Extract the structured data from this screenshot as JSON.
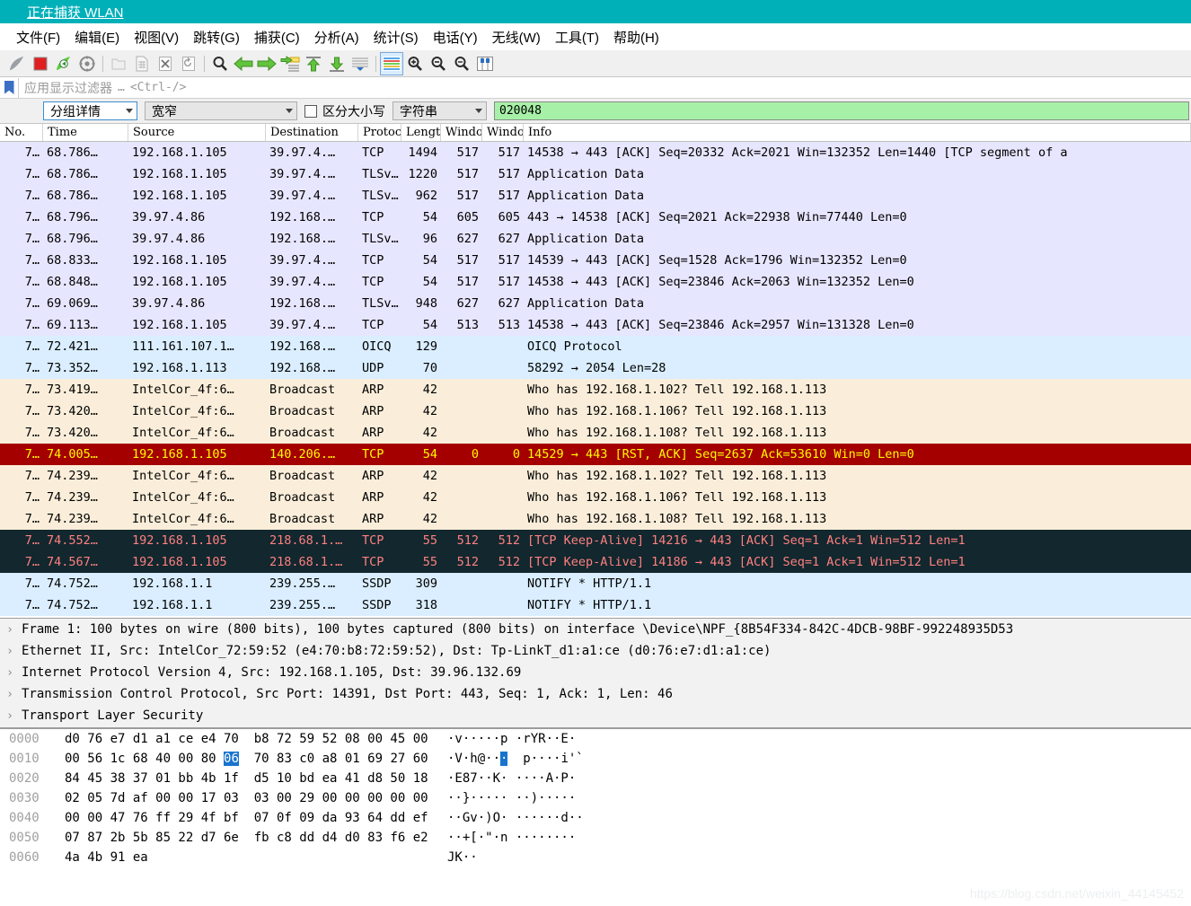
{
  "window": {
    "title": "正在捕获 WLAN",
    "title_icon": "wireshark-shark-fin-icon",
    "titlebar_color": "#00b0b9"
  },
  "menubar": {
    "items": [
      {
        "label": "文件(F)",
        "name": "menu-file"
      },
      {
        "label": "编辑(E)",
        "name": "menu-edit"
      },
      {
        "label": "视图(V)",
        "name": "menu-view"
      },
      {
        "label": "跳转(G)",
        "name": "menu-go"
      },
      {
        "label": "捕获(C)",
        "name": "menu-capture"
      },
      {
        "label": "分析(A)",
        "name": "menu-analyze"
      },
      {
        "label": "统计(S)",
        "name": "menu-statistics"
      },
      {
        "label": "电话(Y)",
        "name": "menu-telephony"
      },
      {
        "label": "无线(W)",
        "name": "menu-wireless"
      },
      {
        "label": "工具(T)",
        "name": "menu-tools"
      },
      {
        "label": "帮助(H)",
        "name": "menu-help"
      }
    ]
  },
  "toolbar": {
    "buttons": [
      {
        "name": "start-capture-icon"
      },
      {
        "name": "stop-capture-icon"
      },
      {
        "name": "restart-capture-icon"
      },
      {
        "name": "capture-options-icon"
      },
      {
        "sep": true
      },
      {
        "name": "open-file-icon"
      },
      {
        "name": "save-file-icon"
      },
      {
        "name": "close-file-icon"
      },
      {
        "name": "reload-file-icon"
      },
      {
        "sep": true
      },
      {
        "name": "find-packet-icon"
      },
      {
        "name": "go-back-icon"
      },
      {
        "name": "go-forward-icon"
      },
      {
        "name": "go-to-packet-icon"
      },
      {
        "name": "go-to-first-packet-icon"
      },
      {
        "name": "go-to-last-packet-icon"
      },
      {
        "name": "auto-scroll-icon"
      },
      {
        "sep": true
      },
      {
        "name": "colorize-packets-icon",
        "active": true
      },
      {
        "name": "zoom-in-icon"
      },
      {
        "name": "zoom-out-icon"
      },
      {
        "name": "zoom-reset-icon"
      },
      {
        "name": "resize-columns-icon"
      }
    ]
  },
  "filterbar": {
    "bookmark_icon": "bookmark-icon",
    "placeholder": "应用显示过滤器",
    "ellipsis": "…",
    "shortcut": "<Ctrl-/>",
    "value": ""
  },
  "findbar": {
    "search_in": {
      "value": "分组详情",
      "name": "search-in-combo"
    },
    "char_width": {
      "value": "宽窄",
      "name": "char-width-combo"
    },
    "case_sensitive": {
      "label": "区分大小写",
      "checked": false
    },
    "search_type": {
      "value": "字符串",
      "name": "search-type-combo"
    },
    "find_value": "020048"
  },
  "packet_list": {
    "columns": [
      {
        "key": "no",
        "label": "No."
      },
      {
        "key": "time",
        "label": "Time"
      },
      {
        "key": "src",
        "label": "Source"
      },
      {
        "key": "dst",
        "label": "Destination"
      },
      {
        "key": "proto",
        "label": "Protoc"
      },
      {
        "key": "len",
        "label": "Lengt"
      },
      {
        "key": "win1",
        "label": "Windo"
      },
      {
        "key": "win2",
        "label": "Windo"
      },
      {
        "key": "info",
        "label": "Info"
      }
    ],
    "rows": [
      {
        "no": "7…",
        "time": "68.786…",
        "src": "192.168.1.105",
        "dst": "39.97.4.…",
        "proto": "TCP",
        "len": "1494",
        "win1": "517",
        "win2": "517",
        "info": "14538 → 443 [ACK] Seq=20332 Ack=2021 Win=132352 Len=1440 [TCP segment of a",
        "style": "bg-tcp"
      },
      {
        "no": "7…",
        "time": "68.786…",
        "src": "192.168.1.105",
        "dst": "39.97.4.…",
        "proto": "TLSv…",
        "len": "1220",
        "win1": "517",
        "win2": "517",
        "info": "Application Data",
        "style": "bg-tcp"
      },
      {
        "no": "7…",
        "time": "68.786…",
        "src": "192.168.1.105",
        "dst": "39.97.4.…",
        "proto": "TLSv…",
        "len": "962",
        "win1": "517",
        "win2": "517",
        "info": "Application Data",
        "style": "bg-tcp"
      },
      {
        "no": "7…",
        "time": "68.796…",
        "src": "39.97.4.86",
        "dst": "192.168.…",
        "proto": "TCP",
        "len": "54",
        "win1": "605",
        "win2": "605",
        "info": "443 → 14538 [ACK] Seq=2021 Ack=22938 Win=77440 Len=0",
        "style": "bg-tcp"
      },
      {
        "no": "7…",
        "time": "68.796…",
        "src": "39.97.4.86",
        "dst": "192.168.…",
        "proto": "TLSv…",
        "len": "96",
        "win1": "627",
        "win2": "627",
        "info": "Application Data",
        "style": "bg-tcp"
      },
      {
        "no": "7…",
        "time": "68.833…",
        "src": "192.168.1.105",
        "dst": "39.97.4.…",
        "proto": "TCP",
        "len": "54",
        "win1": "517",
        "win2": "517",
        "info": "14539 → 443 [ACK] Seq=1528 Ack=1796 Win=132352 Len=0",
        "style": "bg-tcp"
      },
      {
        "no": "7…",
        "time": "68.848…",
        "src": "192.168.1.105",
        "dst": "39.97.4.…",
        "proto": "TCP",
        "len": "54",
        "win1": "517",
        "win2": "517",
        "info": "14538 → 443 [ACK] Seq=23846 Ack=2063 Win=132352 Len=0",
        "style": "bg-tcp"
      },
      {
        "no": "7…",
        "time": "69.069…",
        "src": "39.97.4.86",
        "dst": "192.168.…",
        "proto": "TLSv…",
        "len": "948",
        "win1": "627",
        "win2": "627",
        "info": "Application Data",
        "style": "bg-tcp"
      },
      {
        "no": "7…",
        "time": "69.113…",
        "src": "192.168.1.105",
        "dst": "39.97.4.…",
        "proto": "TCP",
        "len": "54",
        "win1": "513",
        "win2": "513",
        "info": "14538 → 443 [ACK] Seq=23846 Ack=2957 Win=131328 Len=0",
        "style": "bg-tcp"
      },
      {
        "no": "7…",
        "time": "72.421…",
        "src": "111.161.107.1…",
        "dst": "192.168.…",
        "proto": "OICQ",
        "len": "129",
        "win1": "",
        "win2": "",
        "info": "OICQ Protocol",
        "style": "bg-udp"
      },
      {
        "no": "7…",
        "time": "73.352…",
        "src": "192.168.1.113",
        "dst": "192.168.…",
        "proto": "UDP",
        "len": "70",
        "win1": "",
        "win2": "",
        "info": "58292 → 2054 Len=28",
        "style": "bg-udp"
      },
      {
        "no": "7…",
        "time": "73.419…",
        "src": "IntelCor_4f:6…",
        "dst": "Broadcast",
        "proto": "ARP",
        "len": "42",
        "win1": "",
        "win2": "",
        "info": "Who has 192.168.1.102? Tell 192.168.1.113",
        "style": "bg-arp"
      },
      {
        "no": "7…",
        "time": "73.420…",
        "src": "IntelCor_4f:6…",
        "dst": "Broadcast",
        "proto": "ARP",
        "len": "42",
        "win1": "",
        "win2": "",
        "info": "Who has 192.168.1.106? Tell 192.168.1.113",
        "style": "bg-arp"
      },
      {
        "no": "7…",
        "time": "73.420…",
        "src": "IntelCor_4f:6…",
        "dst": "Broadcast",
        "proto": "ARP",
        "len": "42",
        "win1": "",
        "win2": "",
        "info": "Who has 192.168.1.108? Tell 192.168.1.113",
        "style": "bg-arp"
      },
      {
        "no": "7…",
        "time": "74.005…",
        "src": "192.168.1.105",
        "dst": "140.206.…",
        "proto": "TCP",
        "len": "54",
        "win1": "0",
        "win2": "0",
        "info": "14529 → 443 [RST, ACK] Seq=2637 Ack=53610 Win=0 Len=0",
        "style": "bg-bad"
      },
      {
        "no": "7…",
        "time": "74.239…",
        "src": "IntelCor_4f:6…",
        "dst": "Broadcast",
        "proto": "ARP",
        "len": "42",
        "win1": "",
        "win2": "",
        "info": "Who has 192.168.1.102? Tell 192.168.1.113",
        "style": "bg-arp"
      },
      {
        "no": "7…",
        "time": "74.239…",
        "src": "IntelCor_4f:6…",
        "dst": "Broadcast",
        "proto": "ARP",
        "len": "42",
        "win1": "",
        "win2": "",
        "info": "Who has 192.168.1.106? Tell 192.168.1.113",
        "style": "bg-arp"
      },
      {
        "no": "7…",
        "time": "74.239…",
        "src": "IntelCor_4f:6…",
        "dst": "Broadcast",
        "proto": "ARP",
        "len": "42",
        "win1": "",
        "win2": "",
        "info": "Who has 192.168.1.108? Tell 192.168.1.113",
        "style": "bg-arp"
      },
      {
        "no": "7…",
        "time": "74.552…",
        "src": "192.168.1.105",
        "dst": "218.68.1.…",
        "proto": "TCP",
        "len": "55",
        "win1": "512",
        "win2": "512",
        "info": "[TCP Keep-Alive] 14216 → 443 [ACK] Seq=1 Ack=1 Win=512 Len=1",
        "style": "bg-keepalive"
      },
      {
        "no": "7…",
        "time": "74.567…",
        "src": "192.168.1.105",
        "dst": "218.68.1.…",
        "proto": "TCP",
        "len": "55",
        "win1": "512",
        "win2": "512",
        "info": "[TCP Keep-Alive] 14186 → 443 [ACK] Seq=1 Ack=1 Win=512 Len=1",
        "style": "bg-keepalive"
      },
      {
        "no": "7…",
        "time": "74.752…",
        "src": "192.168.1.1",
        "dst": "239.255.…",
        "proto": "SSDP",
        "len": "309",
        "win1": "",
        "win2": "",
        "info": "NOTIFY * HTTP/1.1",
        "style": "bg-udp"
      },
      {
        "no": "7…",
        "time": "74.752…",
        "src": "192.168.1.1",
        "dst": "239.255.…",
        "proto": "SSDP",
        "len": "318",
        "win1": "",
        "win2": "",
        "info": "NOTIFY * HTTP/1.1",
        "style": "bg-udp"
      }
    ]
  },
  "packet_details": {
    "rows": [
      {
        "text": "Frame 1: 100 bytes on wire (800 bits), 100 bytes captured (800 bits) on interface \\Device\\NPF_{8B54F334-842C-4DCB-98BF-992248935D53",
        "arrow": "chevron-right-icon"
      },
      {
        "text": "Ethernet II, Src: IntelCor_72:59:52 (e4:70:b8:72:59:52), Dst: Tp-LinkT_d1:a1:ce (d0:76:e7:d1:a1:ce)",
        "arrow": "chevron-right-icon"
      },
      {
        "text": "Internet Protocol Version 4, Src: 192.168.1.105, Dst: 39.96.132.69",
        "arrow": "chevron-right-icon"
      },
      {
        "text": "Transmission Control Protocol, Src Port: 14391, Dst Port: 443, Seq: 1, Ack: 1, Len: 46",
        "arrow": "chevron-right-icon"
      },
      {
        "text": "Transport Layer Security",
        "arrow": "chevron-right-icon"
      }
    ]
  },
  "packet_bytes": {
    "rows": [
      {
        "offset": "0000",
        "bytes_before": "d0 76 e7 d1 a1 ce e4 70  b8 72 59 52 08 00 45 00",
        "sel": "",
        "bytes_after": "",
        "ascii": "·v·····p ·rYR··E·"
      },
      {
        "offset": "0010",
        "bytes_before": "00 56 1c 68 40 00 80 ",
        "sel": "06",
        "bytes_after": "  70 83 c0 a8 01 69 27 60",
        "ascii": "·V·h@···  p····i'`"
      },
      {
        "offset": "0020",
        "bytes_before": "84 45 38 37 01 bb 4b 1f  d5 10 bd ea 41 d8 50 18",
        "sel": "",
        "bytes_after": "",
        "ascii": "·E87··K· ····A·P·"
      },
      {
        "offset": "0030",
        "bytes_before": "02 05 7d af 00 00 17 03  03 00 29 00 00 00 00 00",
        "sel": "",
        "bytes_after": "",
        "ascii": "··}····· ··)·····"
      },
      {
        "offset": "0040",
        "bytes_before": "00 00 47 76 ff 29 4f bf  07 0f 09 da 93 64 dd ef",
        "sel": "",
        "bytes_after": "",
        "ascii": "··Gv·)O· ······d··"
      },
      {
        "offset": "0050",
        "bytes_before": "07 87 2b 5b 85 22 d7 6e  fb c8 dd d4 d0 83 f6 e2",
        "sel": "",
        "bytes_after": "",
        "ascii": "··+[·\"·n ········"
      },
      {
        "offset": "0060",
        "bytes_before": "4a 4b 91 ea",
        "sel": "",
        "bytes_after": "",
        "ascii": "JK··"
      }
    ]
  },
  "watermark": "https://blog.csdn.net/weixin_44145452"
}
